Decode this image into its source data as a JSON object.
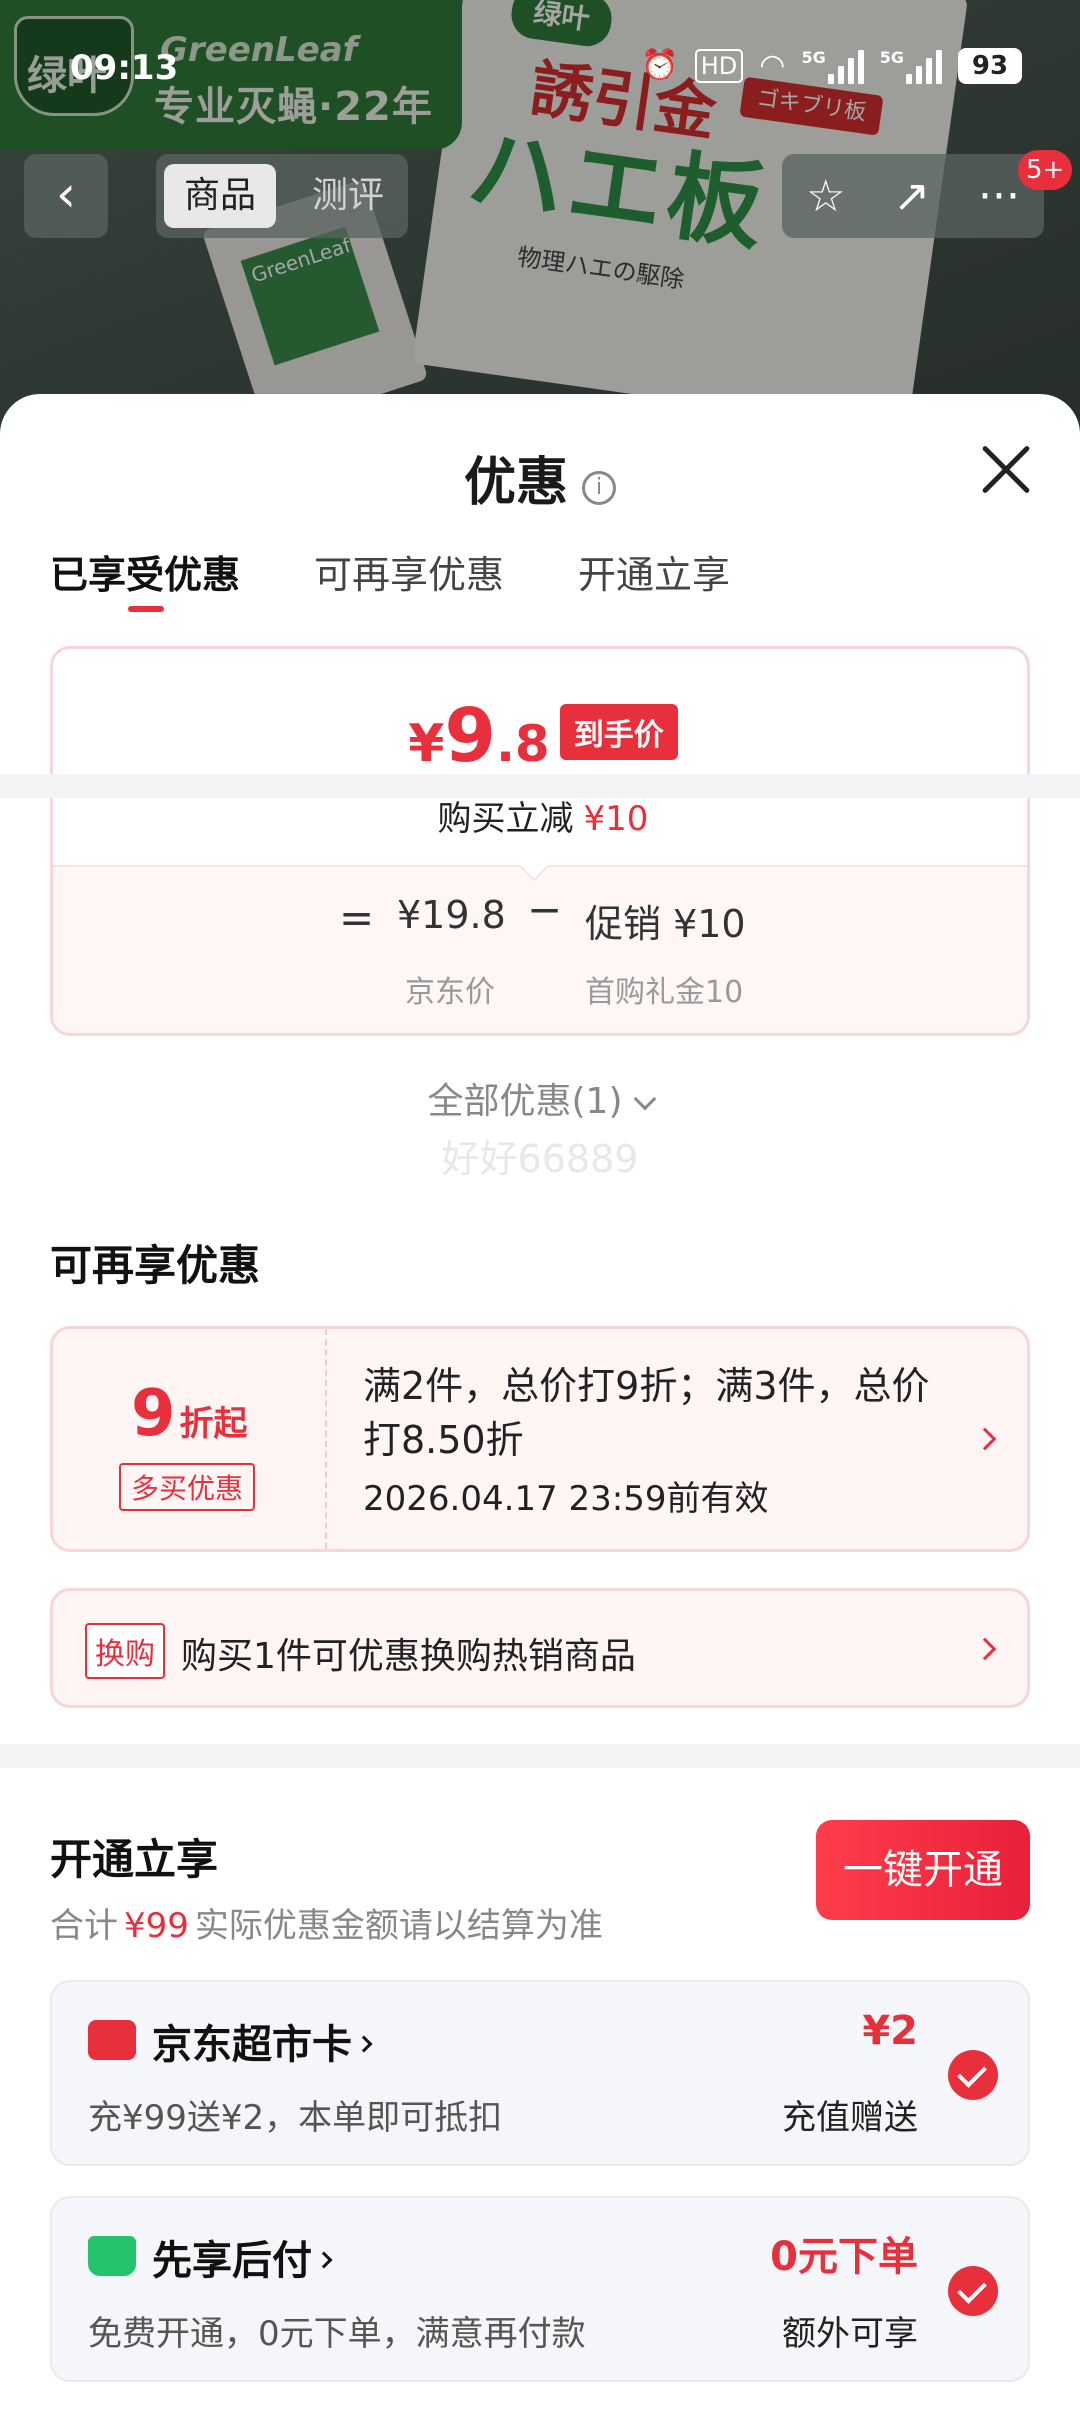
{
  "status_bar": {
    "time": "09:13",
    "hd": "HD",
    "net1": "5G",
    "net2": "5G",
    "battery": "93"
  },
  "hero": {
    "brand_name": "GreenLeaf",
    "brand_slogan": "专业灭蝇·22年",
    "logo_text": "绿叶",
    "box_logo": "绿叶",
    "box_red_title": "誘引金",
    "box_tag": "ゴキブリ板",
    "box_big_title": "ハエ板",
    "box_subtitle": "物理ハエの駆除"
  },
  "nav": {
    "back": "‹",
    "tabs": [
      "商品",
      "测评"
    ],
    "star": "☆",
    "share": "↗",
    "more": "···",
    "badge": "5+"
  },
  "sheet": {
    "title": "优惠",
    "info": "i",
    "tabs": [
      "已享受优惠",
      "可再享优惠",
      "开通立享"
    ],
    "price": {
      "currency": "¥",
      "integer": "9",
      "decimal": ".8",
      "tag": "到手价",
      "reduce_label": "购买立减",
      "reduce_amount": "¥10",
      "eq": "=",
      "jd_price": "¥19.8",
      "minus": "−",
      "promo": "促销 ¥10",
      "jd_label": "京东价",
      "promo_label": "首购礼金10"
    },
    "all_promos": "全部优惠(1)",
    "watermark": "好好66889",
    "reenjoy": {
      "title": "可再享优惠",
      "discount_num": "9",
      "discount_unit": "折起",
      "discount_tag": "多买优惠",
      "discount_desc": "满2件，总价打9折；满3件，总价打8.50折",
      "discount_date": "2026.04.17 23:59前有效",
      "swap_tag": "换购",
      "swap_text": "购买1件可优惠换购热销商品"
    },
    "open": {
      "title": "开通立享",
      "sum_prefix": "合计",
      "sum_amount": "¥99",
      "sum_suffix": "实际优惠金额请以结算为准",
      "button": "一键开通",
      "items": [
        {
          "title": "京东超市卡",
          "desc": "充¥99送¥2，本单即可抵扣",
          "value": "¥2",
          "value_sub": "充值赠送",
          "icon_color": "#e8303d"
        },
        {
          "title": "先享后付",
          "desc": "免费开通，0元下单，满意再付款",
          "value": "0元下单",
          "value_sub": "额外可享",
          "icon_color": "#22c36b"
        }
      ]
    }
  },
  "colors": {
    "accent": "#e8303d",
    "brand_green": "#2f7a3a"
  }
}
